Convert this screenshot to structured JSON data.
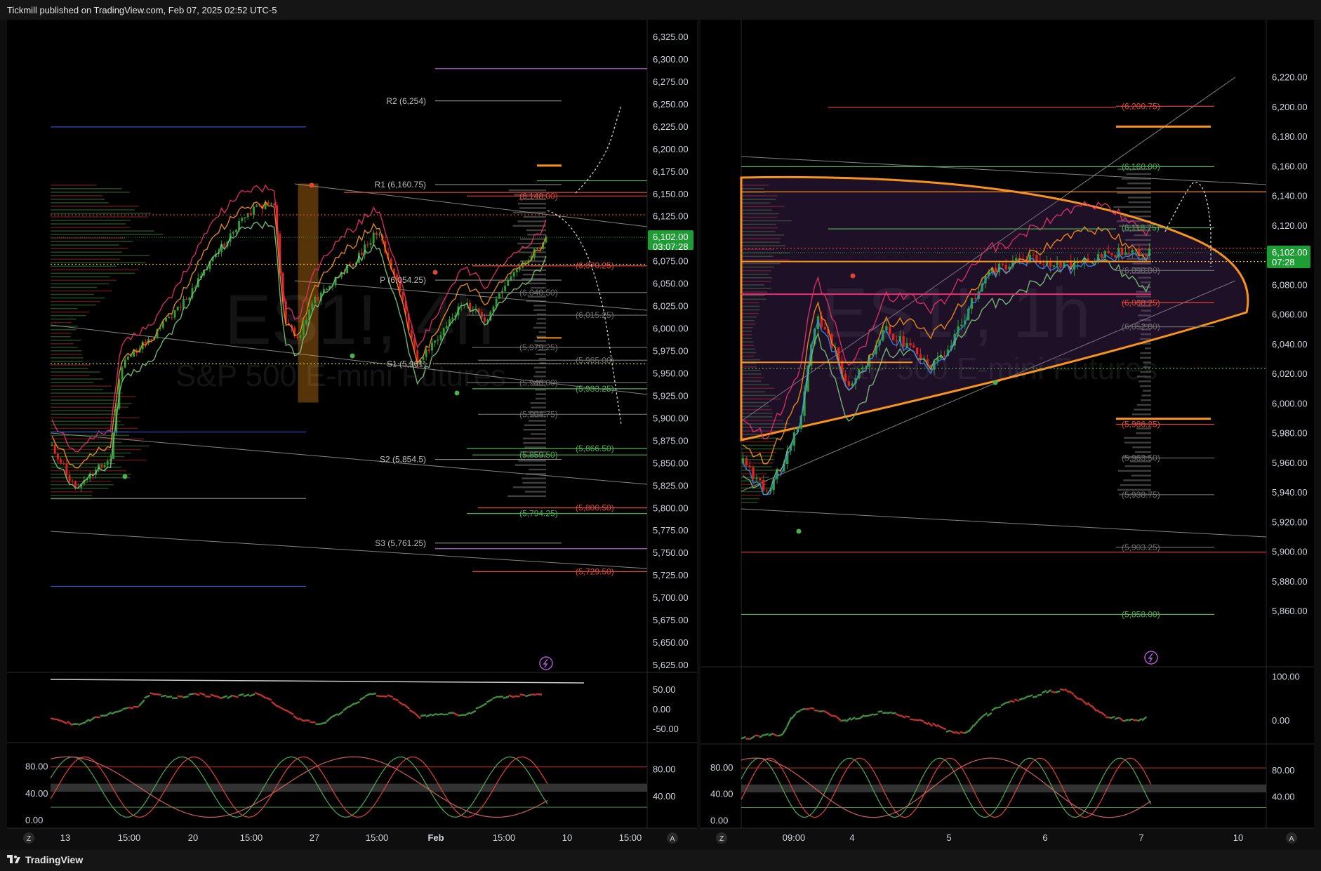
{
  "header": {
    "text": "Tickmill published on TradingView.com, Feb 07, 2025 02:52 UTC-5"
  },
  "footer": {
    "logo_text": "TradingView"
  },
  "colors": {
    "bg": "#000000",
    "up": "#2e9d33",
    "down": "#e0221c",
    "pink": "#e8306f",
    "orange": "#f7941d",
    "green": "#4caf50",
    "grey": "#8c8c8c",
    "purple": "#b05ad0",
    "price_tag": "#1f9d35",
    "price_tag_text": "#ffffff"
  },
  "chart_data": [
    {
      "type": "candlestick",
      "watermark": {
        "symbol": "ES1!, 4h",
        "name": "S&P 500 E-mini Futures"
      },
      "y_ticks": [
        "6,325.00",
        "6,300.00",
        "6,275.00",
        "6,250.00",
        "6,225.00",
        "6,200.00",
        "6,175.00",
        "6,150.00",
        "6,125.00",
        "6,100.00",
        "6,075.00",
        "6,050.00",
        "6,025.00",
        "6,000.00",
        "5,975.00",
        "5,950.00",
        "5,925.00",
        "5,900.00",
        "5,875.00",
        "5,850.00",
        "5,825.00",
        "5,800.00",
        "5,775.00",
        "5,750.00",
        "5,725.00",
        "5,700.00",
        "5,675.00",
        "5,650.00",
        "5,625.00"
      ],
      "ylim": [
        5625,
        6325
      ],
      "x_ticks": [
        "13",
        "15:00",
        "20",
        "15:00",
        "27",
        "15:00",
        "Feb",
        "15:00",
        "10",
        "15:00"
      ],
      "last_price": "6,102.00",
      "countdown": "03:07:28",
      "pivots": [
        {
          "label": "R2 (6,254)",
          "value": 6254
        },
        {
          "label": "R1 (6,160.75)",
          "value": 6160.75
        },
        {
          "label": "P (6,054.25)",
          "value": 6054.25
        },
        {
          "label": "S1 (5,961)",
          "value": 5961
        },
        {
          "label": "S2 (5,854.5)",
          "value": 5854.5
        },
        {
          "label": "S3 (5,761.25)",
          "value": 5761.25
        }
      ],
      "levels": [
        {
          "label": "(6,148.00)",
          "value": 6148.0,
          "color": "red"
        },
        {
          "label": "(6,070.25)",
          "value": 6070.25,
          "color": "red"
        },
        {
          "label": "(6,040.50)",
          "value": 6040.5,
          "color": "grey"
        },
        {
          "label": "(6,015.25)",
          "value": 6015.25,
          "color": "grey"
        },
        {
          "label": "(5,979.25)",
          "value": 5979.25,
          "color": "grey"
        },
        {
          "label": "(5,965.00)",
          "value": 5965.0,
          "color": "grey"
        },
        {
          "label": "(5,940.00)",
          "value": 5940.0,
          "color": "grey"
        },
        {
          "label": "(5,933.25)",
          "value": 5933.25,
          "color": "green"
        },
        {
          "label": "(5,904.75)",
          "value": 5904.75,
          "color": "grey"
        },
        {
          "label": "(5,866.50)",
          "value": 5866.5,
          "color": "green"
        },
        {
          "label": "(5,859.50)",
          "value": 5859.5,
          "color": "green"
        },
        {
          "label": "(5,800.50)",
          "value": 5800.5,
          "color": "red"
        },
        {
          "label": "(5,794.25)",
          "value": 5794.25,
          "color": "green"
        },
        {
          "label": "(5,729.50)",
          "value": 5729.5,
          "color": "red"
        }
      ],
      "osc1": {
        "ticks": [
          "50.00",
          "0.00",
          "-50.00"
        ],
        "ylim": [
          -70,
          80
        ]
      },
      "osc2": {
        "ticks": [
          "80.00",
          "40.00",
          "0.00"
        ],
        "right_ticks": [
          "80.00",
          "40.00"
        ],
        "ylim": [
          -5,
          110
        ]
      }
    },
    {
      "type": "candlestick",
      "watermark": {
        "symbol": "ES1!, 1h",
        "name": "S&P 500 E-mini Futures"
      },
      "y_ticks": [
        "6,220.00",
        "6,200.00",
        "6,180.00",
        "6,160.00",
        "6,140.00",
        "6,120.00",
        "6,100.00",
        "6,080.00",
        "6,060.00",
        "6,040.00",
        "6,020.00",
        "6,000.00",
        "5,980.00",
        "5,960.00",
        "5,940.00",
        "5,920.00",
        "5,900.00",
        "5,880.00",
        "5,860.00"
      ],
      "ylim": [
        5844,
        6226
      ],
      "x_ticks": [
        "09:00",
        "4",
        "5",
        "6",
        "7",
        "10"
      ],
      "last_price": "6,102.00",
      "countdown": "07:28",
      "levels": [
        {
          "label": "(6,200.75)",
          "value": 6200.75,
          "color": "red"
        },
        {
          "label": "(6,160.00)",
          "value": 6160.0,
          "color": "green"
        },
        {
          "label": "(6,118.75)",
          "value": 6118.75,
          "color": "green"
        },
        {
          "label": "(6,090.00)",
          "value": 6090.0,
          "color": "grey"
        },
        {
          "label": "(6,068.25)",
          "value": 6068.25,
          "color": "red"
        },
        {
          "label": "(6,052.00)",
          "value": 6052.0,
          "color": "grey"
        },
        {
          "label": "(5,986.25)",
          "value": 5986.25,
          "color": "red"
        },
        {
          "label": "(5,963.50)",
          "value": 5963.5,
          "color": "grey"
        },
        {
          "label": "(5,938.75)",
          "value": 5938.75,
          "color": "grey"
        },
        {
          "label": "(5,903.25)",
          "value": 5903.25,
          "color": "grey"
        },
        {
          "label": "(5,858.00)",
          "value": 5858.0,
          "color": "green"
        }
      ],
      "osc1": {
        "ticks": [
          "100.00",
          "0.00"
        ],
        "ylim": [
          -40,
          110
        ]
      },
      "osc2": {
        "ticks": [
          "80.00",
          "40.00",
          "0.00"
        ],
        "right_ticks": [
          "80.00",
          "40.00"
        ],
        "ylim": [
          -5,
          110
        ]
      }
    }
  ]
}
